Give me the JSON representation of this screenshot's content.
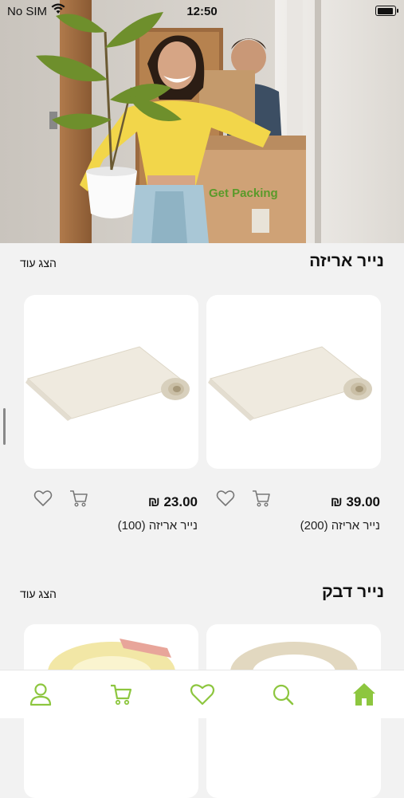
{
  "status_bar": {
    "carrier": "No SIM",
    "time": "12:50"
  },
  "hero": {
    "box_brand": "Get Packing"
  },
  "sections": [
    {
      "title": "נייר אריזה",
      "show_more": "הצג עוד",
      "products": [
        {
          "name": "נייר אריזה (200)",
          "price": "39.00 ₪"
        },
        {
          "name": "נייר אריזה (100)",
          "price": "23.00 ₪"
        }
      ]
    },
    {
      "title": "נייר דבק",
      "show_more": "הצג עוד"
    }
  ],
  "colors": {
    "accent": "#8dc63f",
    "background": "#f2f2f2"
  },
  "tab_bar": [
    "home-icon",
    "search-icon",
    "heart-icon",
    "cart-icon",
    "user-icon"
  ]
}
